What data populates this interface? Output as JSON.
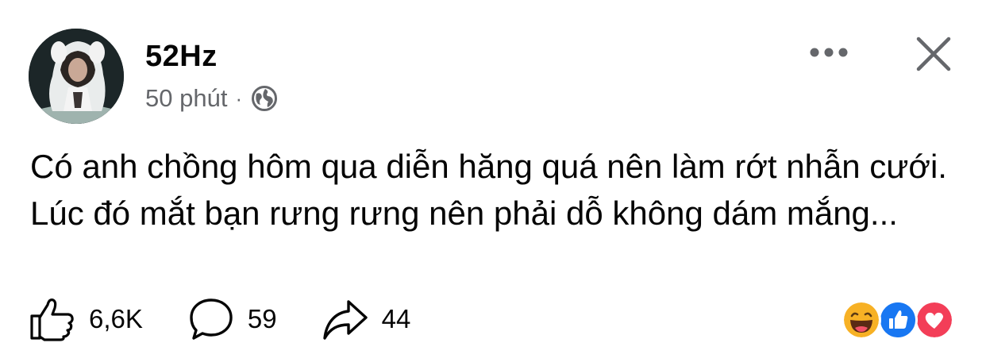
{
  "post": {
    "author": "52Hz",
    "time": "50 phút",
    "separator": "·",
    "privacy_icon": "globe-icon",
    "text": "Có anh chồng hôm qua diễn hăng quá nên làm rớt nhẫn cưới. Lúc đó mắt bạn rưng rưng nên phải dỗ không dám mắng..."
  },
  "header_controls": {
    "more_icon": "more-dots-icon",
    "close_icon": "close-icon"
  },
  "actions": {
    "like_count": "6,6K",
    "comment_count": "59",
    "share_count": "44"
  },
  "reactions": [
    "haha",
    "like",
    "love"
  ],
  "colors": {
    "text": "#050505",
    "secondary": "#65676b",
    "like_blue": "#1877f2",
    "love_red": "#f33e58",
    "haha_yellow": "#f7b125"
  }
}
